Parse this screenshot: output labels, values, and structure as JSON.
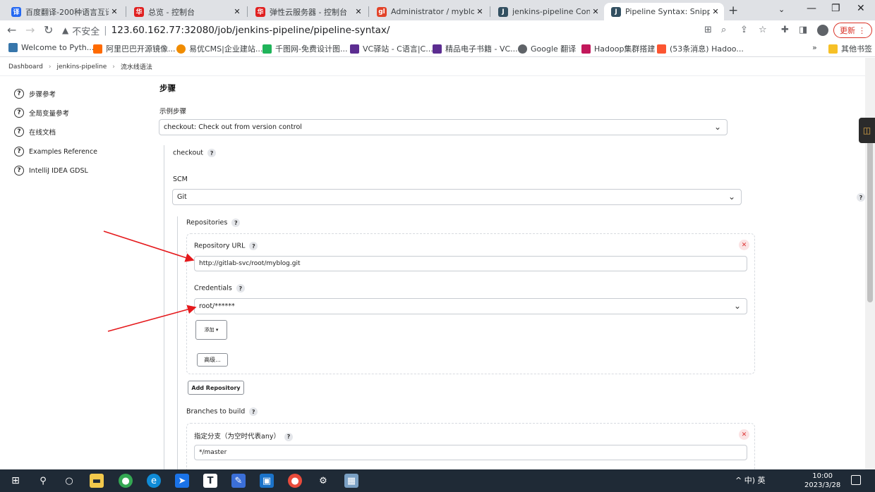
{
  "browser": {
    "tabs": [
      {
        "title": "百度翻译-200种语言互译、",
        "favicon": "译",
        "color": "#2468f2"
      },
      {
        "title": "总览 - 控制台",
        "favicon": "华",
        "color": "#e02020"
      },
      {
        "title": "弹性云服务器 - 控制台",
        "favicon": "华",
        "color": "#e02020"
      },
      {
        "title": "Administrator / myblog",
        "favicon": "gl",
        "color": "#e24329"
      },
      {
        "title": "jenkins-pipeline Config [J",
        "favicon": "J",
        "color": "#335061"
      },
      {
        "title": "Pipeline Syntax: Snippet G",
        "favicon": "J",
        "color": "#335061",
        "active": true
      }
    ],
    "address": {
      "security_label": "不安全",
      "url": "123.60.162.77:32080/job/jenkins-pipeline/pipeline-syntax/"
    },
    "update_label": "更新",
    "bookmarks": [
      {
        "label": "Welcome to Pyth...",
        "color": "#3776ab"
      },
      {
        "label": "阿里巴巴开源镜像...",
        "color": "#ff6a00"
      },
      {
        "label": "易优CMS|企业建站...",
        "color": "#f08c00"
      },
      {
        "label": "千图网-免费设计图...",
        "color": "#20b45a"
      },
      {
        "label": "VC驿站 - C语言|C...",
        "color": "#5c2d91"
      },
      {
        "label": "精品电子书籍 - VC...",
        "color": "#5c2d91"
      },
      {
        "label": "Google 翻译",
        "color": "#5f6368"
      },
      {
        "label": "Hadoop集群搭建",
        "color": "#c2185b"
      },
      {
        "label": "(53条消息) Hadoo...",
        "color": "#fc5531"
      }
    ],
    "bookmarks_more": "»",
    "other_bookmarks": "其他书签"
  },
  "breadcrumb": [
    "Dashboard",
    "jenkins-pipeline",
    "流水线语法"
  ],
  "sidebar": {
    "items": [
      {
        "label": "步骤参考"
      },
      {
        "label": "全局变量参考"
      },
      {
        "label": "在线文档"
      },
      {
        "label": "Examples Reference"
      },
      {
        "label": "IntelliJ IDEA GDSL"
      }
    ]
  },
  "main": {
    "section_title": "步骤",
    "sample_step_label": "示例步骤",
    "sample_step_value": "checkout: Check out from version control",
    "checkout_label": "checkout",
    "scm_label": "SCM",
    "scm_value": "Git",
    "repositories_label": "Repositories",
    "repo_url_label": "Repository URL",
    "repo_url_value": "http://gitlab-svc/root/myblog.git",
    "credentials_label": "Credentials",
    "credentials_value": "root/******",
    "add_button": "添加",
    "advanced_button": "高级...",
    "add_repository_button": "Add Repository",
    "branches_label": "Branches to build",
    "branch_specifier_label": "指定分支（为空时代表any）",
    "branch_value": "*/master"
  },
  "taskbar": {
    "tray_text": "^ 中) 英",
    "time": "10:00",
    "date": "2023/3/28"
  }
}
